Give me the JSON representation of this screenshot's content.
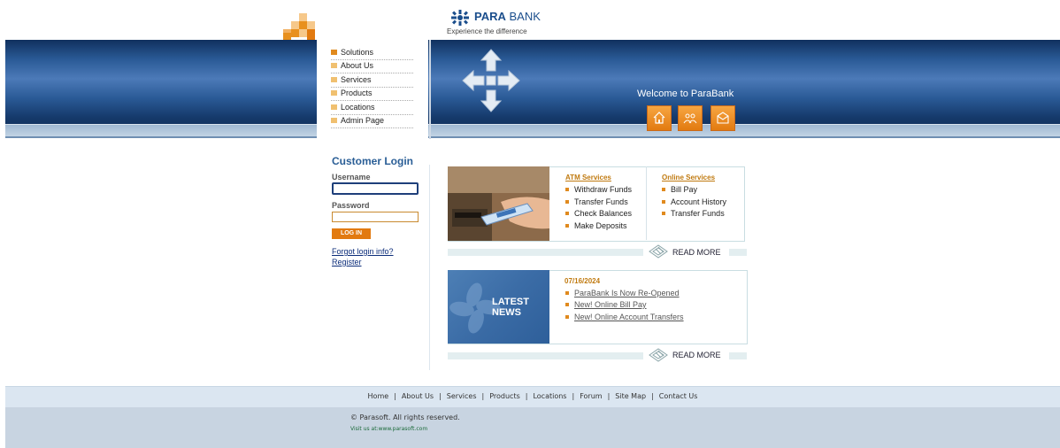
{
  "brand": {
    "name_bold": "PARA",
    "name_rest": " BANK",
    "tagline": "Experience the difference"
  },
  "nav": {
    "items": [
      {
        "label": "Solutions"
      },
      {
        "label": "About Us"
      },
      {
        "label": "Services"
      },
      {
        "label": "Products"
      },
      {
        "label": "Locations"
      },
      {
        "label": "Admin Page"
      }
    ]
  },
  "header": {
    "welcome": "Welcome to ParaBank",
    "icons": [
      "home-icon",
      "about-icon",
      "contact-icon"
    ]
  },
  "login": {
    "title": "Customer Login",
    "username_label": "Username",
    "username_value": "",
    "password_label": "Password",
    "password_value": "",
    "button": "LOG IN",
    "forgot": "Forgot login info?",
    "register": "Register"
  },
  "atm": {
    "title": "ATM Services",
    "items": [
      "Withdraw Funds",
      "Transfer Funds",
      "Check Balances",
      "Make Deposits"
    ]
  },
  "online": {
    "title": "Online Services",
    "items": [
      "Bill Pay",
      "Account History",
      "Transfer Funds"
    ]
  },
  "read_more": "READ MORE",
  "news": {
    "label_line1": "LATEST",
    "label_line2": "NEWS",
    "date": "07/16/2024",
    "items": [
      "ParaBank Is Now Re-Opened",
      "New! Online Bill Pay",
      "New! Online Account Transfers"
    ]
  },
  "footer": {
    "links": [
      "Home",
      "About Us",
      "Services",
      "Products",
      "Locations",
      "Forum",
      "Site Map",
      "Contact Us"
    ],
    "separator": "|",
    "copyright": "© Parasoft. All rights reserved.",
    "visit": "Visit us at:www.parasoft.com"
  },
  "colors": {
    "brand_blue": "#1b4e8c",
    "accent_orange": "#e27a10",
    "link_blue": "#0c2d7a"
  }
}
